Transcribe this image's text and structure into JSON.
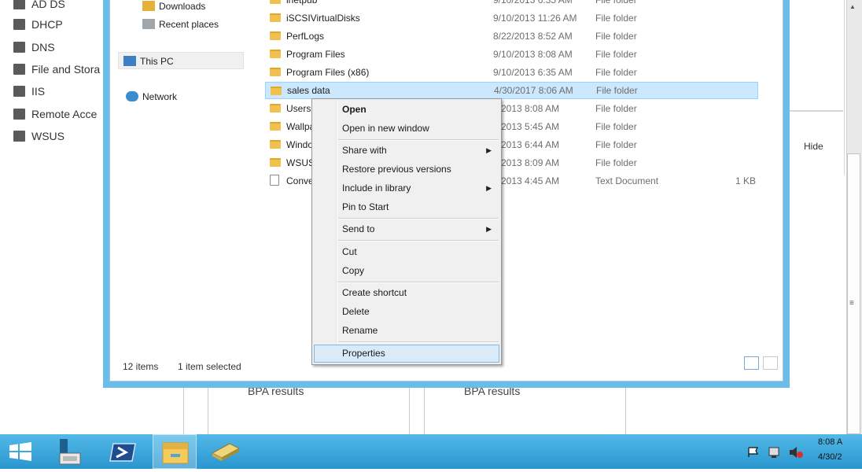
{
  "server_manager": {
    "nav_items": [
      {
        "label": "AD DS",
        "icon": "ad-ds-icon"
      },
      {
        "label": "DHCP",
        "icon": "dhcp-icon"
      },
      {
        "label": "DNS",
        "icon": "dns-icon"
      },
      {
        "label": "File and Stora",
        "icon": "file-storage-icon"
      },
      {
        "label": "IIS",
        "icon": "iis-icon"
      },
      {
        "label": "Remote Acce",
        "icon": "remote-access-icon"
      },
      {
        "label": "WSUS",
        "icon": "wsus-icon"
      }
    ],
    "hide_label": "Hide",
    "bpa_labels": [
      "BPA results",
      "BPA results"
    ]
  },
  "explorer": {
    "nav_tree": [
      {
        "label": "Downloads",
        "icon": "downloads-icon"
      },
      {
        "label": "Recent places",
        "icon": "recent-places-icon"
      },
      {
        "label": "This PC",
        "icon": "this-pc-icon"
      },
      {
        "label": "Network",
        "icon": "network-icon"
      }
    ],
    "files": [
      {
        "name": "inetpub",
        "date": "9/10/2013 6:35 AM",
        "type": "File folder",
        "size": ""
      },
      {
        "name": "iSCSIVirtualDisks",
        "date": "9/10/2013 11:26 AM",
        "type": "File folder",
        "size": ""
      },
      {
        "name": "PerfLogs",
        "date": "8/22/2013 8:52 AM",
        "type": "File folder",
        "size": ""
      },
      {
        "name": "Program Files",
        "date": "9/10/2013 8:08 AM",
        "type": "File folder",
        "size": ""
      },
      {
        "name": "Program Files (x86)",
        "date": "9/10/2013 6:35 AM",
        "type": "File folder",
        "size": ""
      },
      {
        "name": "sales data",
        "date": "4/30/2017 8:06 AM",
        "type": "File folder",
        "size": "",
        "selected": true
      },
      {
        "name": "Users",
        "date": "0/2013 8:08 AM",
        "type": "File folder",
        "size": ""
      },
      {
        "name": "Wallpa",
        "date": "0/2013 5:45 AM",
        "type": "File folder",
        "size": ""
      },
      {
        "name": "Window",
        "date": "0/2013 6:44 AM",
        "type": "File folder",
        "size": ""
      },
      {
        "name": "WSUS",
        "date": "0/2013 8:09 AM",
        "type": "File folder",
        "size": ""
      },
      {
        "name": "Conver",
        "date": "0/2013 4:45 AM",
        "type": "Text Document",
        "size": "1 KB"
      }
    ],
    "status": {
      "item_count": "12 items",
      "selection": "1 item selected"
    }
  },
  "context_menu": {
    "items": [
      {
        "label": "Open",
        "bold": true
      },
      {
        "label": "Open in new window"
      },
      {
        "label": "Share with",
        "submenu": true
      },
      {
        "label": "Restore previous versions"
      },
      {
        "label": "Include in library",
        "submenu": true
      },
      {
        "label": "Pin to Start"
      },
      {
        "label": "Send to",
        "submenu": true
      },
      {
        "label": "Cut"
      },
      {
        "label": "Copy"
      },
      {
        "label": "Create shortcut"
      },
      {
        "label": "Delete"
      },
      {
        "label": "Rename"
      },
      {
        "label": "Properties",
        "highlighted": true
      }
    ]
  },
  "taskbar": {
    "buttons": [
      "start-icon",
      "server-manager-icon",
      "powershell-icon",
      "file-explorer-icon",
      "toolbox-icon"
    ],
    "clock_time": "8:08 A",
    "clock_date": "4/30/2"
  },
  "colors": {
    "accent": "#2a96cf",
    "window_frame": "#6bbce6",
    "selection": "#cce8ff",
    "menu_highlight": "#d9ebf9"
  }
}
